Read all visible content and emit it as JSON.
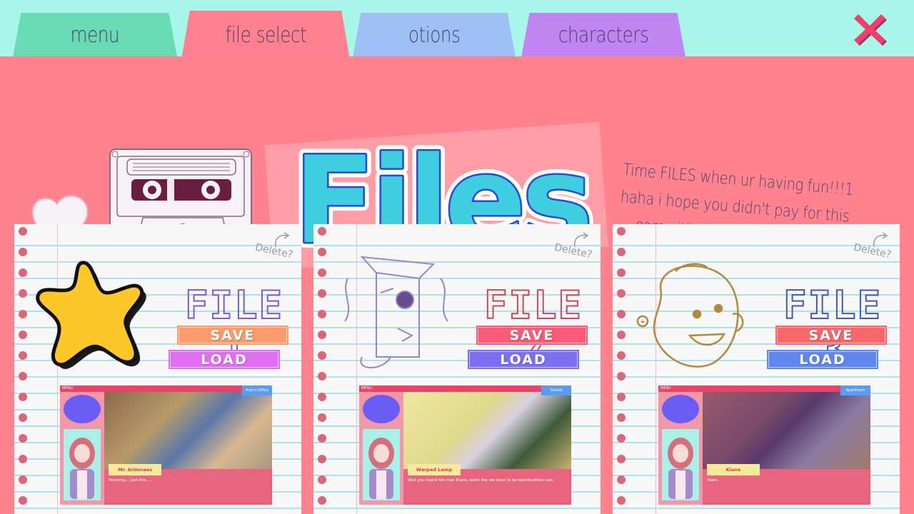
{
  "tabs": [
    {
      "label": "menu",
      "active": false
    },
    {
      "label": "file select",
      "active": true
    },
    {
      "label": "otions",
      "active": false
    },
    {
      "label": "characters",
      "active": false
    }
  ],
  "header": {
    "title": "Files",
    "joke_lines": [
      "Time FILES when ur having fun!!!1",
      "haha i hope you didn't pay for this",
      "game it's not very good"
    ]
  },
  "colors": {
    "background": "#a8f5ea",
    "panel": "#ff828f",
    "close": "#f0406a"
  },
  "files": [
    {
      "label": "FILE 1",
      "delete_label": "Delete?",
      "save_label": "SAVE",
      "load_label": "LOAD",
      "save_color": "#fb9a6d",
      "load_color": "#df6ff0",
      "art": "star-icon",
      "preview": {
        "menu_label": "MENU",
        "location": "Arim's Office",
        "speaker": "Mr. Arimnaes",
        "dialogue": "Hmmmp... Just this....."
      }
    },
    {
      "label": "FILE 2",
      "delete_label": "Delete?",
      "save_label": "SAVE",
      "load_label": "LOAD",
      "save_color": "#f95c79",
      "load_color": "#7c6ff0",
      "art": "warped-lamp-sketch",
      "preview": {
        "menu_label": "MENU",
        "location": "School",
        "speaker": "Warped Lamp",
        "dialogue": "Well you heard hte man Kiane, looks like we have to be learnbuddies now."
      }
    },
    {
      "label": "FILE 3",
      "delete_label": "Delete?",
      "save_label": "SAVE",
      "load_label": "LOAD",
      "save_color": "#f8676a",
      "load_color": "#5f88ee",
      "art": "character-face-sketch",
      "preview": {
        "menu_label": "MENU",
        "location": "Apartment",
        "speaker": "Kiane",
        "dialogue": "Yawn..."
      }
    }
  ]
}
